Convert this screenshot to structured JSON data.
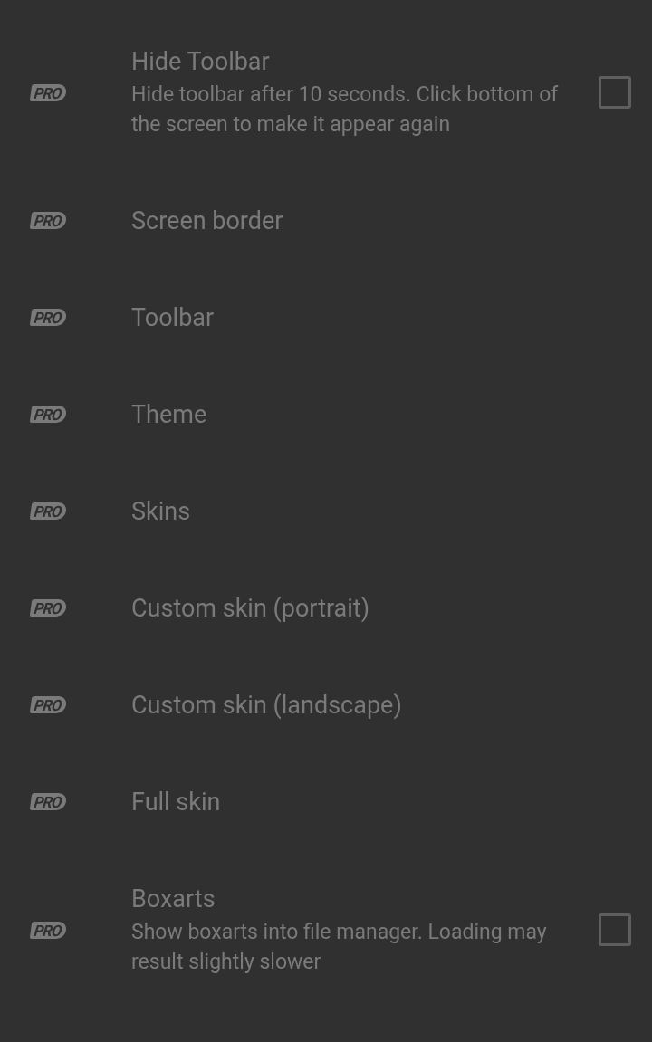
{
  "settings": [
    {
      "badge": "PRO",
      "title": "Hide Toolbar",
      "summary": "Hide toolbar after 10 seconds. Click bottom of the screen to make it appear again",
      "disabled": true,
      "kind": "checkbox",
      "checked": false
    },
    {
      "badge": "PRO",
      "title": "Screen border",
      "disabled": true,
      "kind": "plain"
    },
    {
      "badge": "PRO",
      "title": "Toolbar",
      "disabled": true,
      "kind": "plain"
    },
    {
      "badge": "PRO",
      "title": "Theme",
      "disabled": true,
      "kind": "plain"
    },
    {
      "badge": "PRO",
      "title": "Skins",
      "disabled": true,
      "kind": "plain"
    },
    {
      "badge": "PRO",
      "title": "Custom skin (portrait)",
      "disabled": true,
      "kind": "plain"
    },
    {
      "badge": "PRO",
      "title": "Custom skin (landscape)",
      "disabled": true,
      "kind": "plain"
    },
    {
      "badge": "PRO",
      "title": "Full skin",
      "disabled": true,
      "kind": "plain"
    },
    {
      "badge": "PRO",
      "title": "Boxarts",
      "summary": "Show boxarts into file manager. Loading may result slightly slower",
      "disabled": true,
      "kind": "checkbox",
      "checked": false
    }
  ]
}
